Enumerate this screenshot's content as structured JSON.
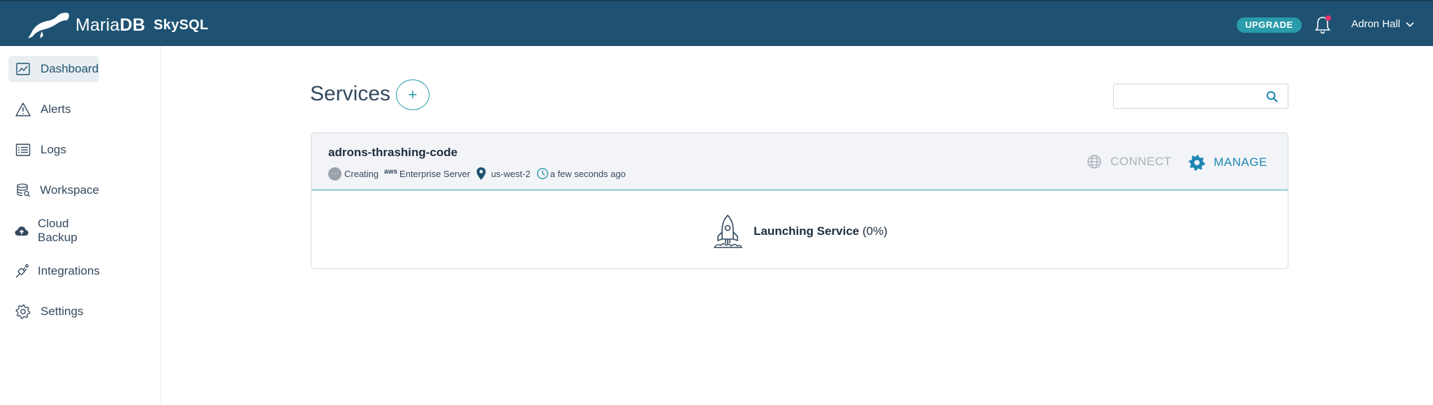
{
  "header": {
    "logo_brand": "Maria",
    "logo_brand_suffix": "DB",
    "logo_product": "SkySQL",
    "upgrade_label": "UPGRADE",
    "user_name": "Adron Hall"
  },
  "sidebar": {
    "items": [
      {
        "label": "Dashboard",
        "icon": "dashboard-icon",
        "active": true
      },
      {
        "label": "Alerts",
        "icon": "alert-icon"
      },
      {
        "label": "Logs",
        "icon": "logs-icon"
      },
      {
        "label": "Workspace",
        "icon": "workspace-icon"
      },
      {
        "label": "Cloud Backup",
        "icon": "cloud-backup-icon"
      },
      {
        "label": "Integrations",
        "icon": "integrations-icon"
      },
      {
        "label": "Settings",
        "icon": "gear-icon"
      }
    ]
  },
  "main": {
    "title": "Services",
    "add_label": "+",
    "search": {
      "value": "",
      "placeholder": ""
    }
  },
  "service": {
    "name": "adrons-thrashing-code",
    "status": "Creating",
    "status_dot": "···",
    "provider": "aws",
    "product": "Enterprise Server",
    "region": "us-west-2",
    "created": "a few seconds ago",
    "connect_label": "CONNECT",
    "manage_label": "MANAGE",
    "launch_label": "Launching Service",
    "launch_progress": "(0%)"
  },
  "colors": {
    "topbar": "#1f5272",
    "accent": "#2a9bab",
    "manage": "#1e86b4",
    "notification": "#e8336b"
  }
}
